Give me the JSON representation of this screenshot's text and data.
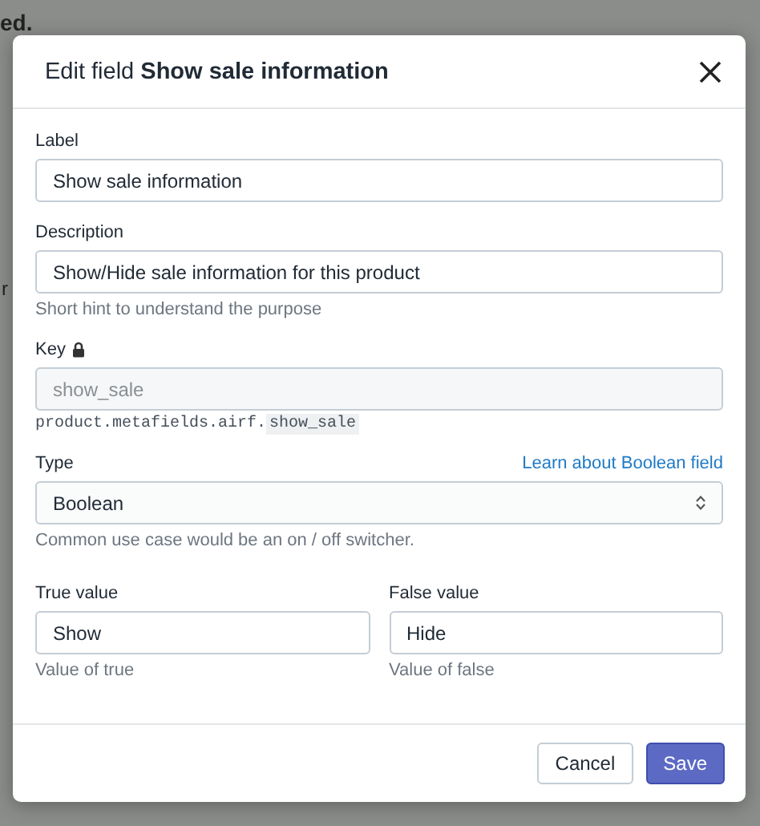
{
  "background": {
    "texts": [
      {
        "text": "ed.",
        "kind": "top"
      },
      {
        "text": "r",
        "kind": "side"
      }
    ]
  },
  "dialog": {
    "title": "Edit field **Show sale information**",
    "fields": [
      {
        "kind": "text",
        "label": "Label",
        "value": "Show sale information"
      },
      {
        "kind": "text",
        "label": "Description",
        "value": "Show/Hide sale information for this product",
        "hint": "Short hint to understand the purpose"
      },
      {
        "kind": "key",
        "label": "Key",
        "locked": true,
        "disabled": true,
        "value": "show_sale",
        "path_prefix": "product.metafields.airf.",
        "path_key": "show_sale"
      },
      {
        "kind": "select",
        "label": "Type",
        "link": "Learn about Boolean field",
        "value": "Boolean",
        "hint": "Common use case would be an on / off switcher."
      },
      {
        "kind": "pair",
        "items": [
          {
            "label": "True value",
            "value": "Show",
            "hint": "Value of true"
          },
          {
            "label": "False value",
            "value": "Hide",
            "hint": "Value of false"
          }
        ]
      }
    ],
    "buttons": [
      {
        "label": "Cancel",
        "kind": "secondary"
      },
      {
        "label": "Save",
        "kind": "primary"
      }
    ]
  }
}
